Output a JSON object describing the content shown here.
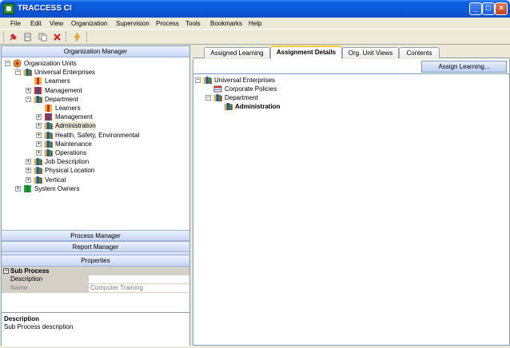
{
  "window": {
    "title": "TRACCESS CI"
  },
  "menu": [
    "File",
    "Edit",
    "View",
    "Organization",
    "Supervision",
    "Process",
    "Tools",
    "Bookmarks",
    "Help"
  ],
  "left": {
    "org_manager_title": "Organization Manager",
    "tree": [
      {
        "label": "Organization Units",
        "level": 0,
        "expander": "-",
        "icon": "org-units-icon"
      },
      {
        "label": "Universal Enterprises",
        "level": 1,
        "expander": "-",
        "icon": "enterprise-icon"
      },
      {
        "label": "Learners",
        "level": 2,
        "expander": "",
        "icon": "learners-icon"
      },
      {
        "label": "Management",
        "level": 2,
        "expander": "+",
        "icon": "management-icon"
      },
      {
        "label": "Department",
        "level": 2,
        "expander": "-",
        "icon": "department-icon"
      },
      {
        "label": "Learners",
        "level": 3,
        "expander": "",
        "icon": "learners-icon"
      },
      {
        "label": "Management",
        "level": 3,
        "expander": "+",
        "icon": "management-icon"
      },
      {
        "label": "Administration",
        "level": 3,
        "expander": "+",
        "icon": "department-icon",
        "selected": true
      },
      {
        "label": "Health, Safety, Environmental",
        "level": 3,
        "expander": "+",
        "icon": "department-icon"
      },
      {
        "label": "Maintenance",
        "level": 3,
        "expander": "+",
        "icon": "department-icon"
      },
      {
        "label": "Operations",
        "level": 3,
        "expander": "+",
        "icon": "department-icon"
      },
      {
        "label": "Job Description",
        "level": 2,
        "expander": "+",
        "icon": "department-icon"
      },
      {
        "label": "Physical Location",
        "level": 2,
        "expander": "+",
        "icon": "department-icon"
      },
      {
        "label": "Vertical",
        "level": 2,
        "expander": "+",
        "icon": "department-icon"
      },
      {
        "label": "System Owners",
        "level": 1,
        "expander": "+",
        "icon": "system-owners-icon"
      }
    ],
    "process_manager_title": "Process Manager",
    "report_manager_title": "Report Manager",
    "properties_title": "Properties",
    "properties": {
      "category": "Sub Process",
      "rows": [
        {
          "name": "Description",
          "value": ""
        },
        {
          "name": "Name",
          "value": "Computer Training"
        }
      ],
      "description_title": "Description",
      "description_text": "Sub Process description"
    }
  },
  "right": {
    "tabs": [
      {
        "label": "Assigned Learning",
        "active": false
      },
      {
        "label": "Assignment Details",
        "active": true
      },
      {
        "label": "Org. Unit Views",
        "active": false
      },
      {
        "label": "Contents",
        "active": false
      }
    ],
    "assign_button": "Assign Learning...",
    "tree": [
      {
        "label": "Universal Enterprises",
        "level": 0,
        "expander": "-",
        "icon": "enterprise-icon",
        "bold": false
      },
      {
        "label": "Corporate Policies",
        "level": 1,
        "expander": "",
        "icon": "policies-icon",
        "bold": false
      },
      {
        "label": "Department",
        "level": 1,
        "expander": "-",
        "icon": "department-icon",
        "bold": false
      },
      {
        "label": "Administration",
        "level": 2,
        "expander": "",
        "icon": "department-icon",
        "bold": true
      }
    ]
  },
  "colors": {
    "titlebar": "#0A5FE0",
    "panel_header": "#C7D6F4",
    "tab_highlight": "#FFC83C"
  }
}
